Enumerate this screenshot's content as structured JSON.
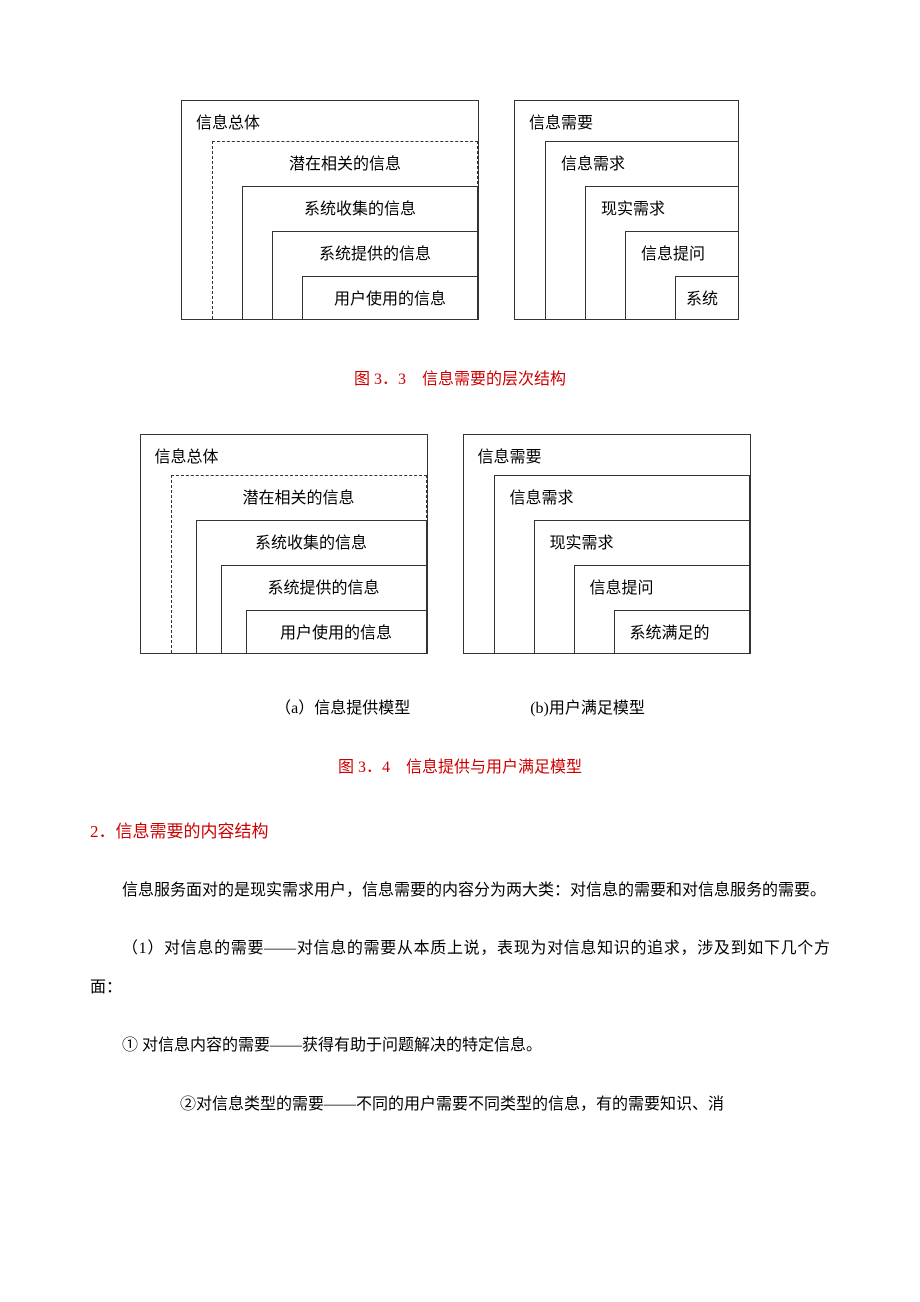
{
  "diagram1": {
    "left": {
      "title": "信息总体",
      "l1": "潜在相关的信息",
      "l2": "系统收集的信息",
      "l3": "系统提供的信息",
      "l4": "用户使用的信息"
    },
    "right": {
      "title": "信息需要",
      "l1": "信息需求",
      "l2": "现实需求",
      "l3": "信息提问",
      "l4": "系统"
    }
  },
  "caption1": "图 3．3　信息需要的层次结构",
  "diagram2": {
    "left": {
      "title": "信息总体",
      "l1": "潜在相关的信息",
      "l2": "系统收集的信息",
      "l3": "系统提供的信息",
      "l4": "用户使用的信息"
    },
    "right": {
      "title": "信息需要",
      "l1": "信息需求",
      "l2": "现实需求",
      "l3": "信息提问",
      "l4": "系统满足的"
    }
  },
  "subcaption_a": "（a）信息提供模型",
  "subcaption_b": "(b)用户满足模型",
  "caption2": "图 3．4　信息提供与用户满足模型",
  "heading": "2．信息需要的内容结构",
  "p1": "信息服务面对的是现实需求用户，信息需要的内容分为两大类：对信息的需要和对信息服务的需要。",
  "p2": "（1）对信息的需要——对信息的需要从本质上说，表现为对信息知识的追求，涉及到如下几个方面：",
  "p3": "① 对信息内容的需要——获得有助于问题解决的特定信息。",
  "p4": "②对信息类型的需要——不同的用户需要不同类型的信息，有的需要知识、消"
}
